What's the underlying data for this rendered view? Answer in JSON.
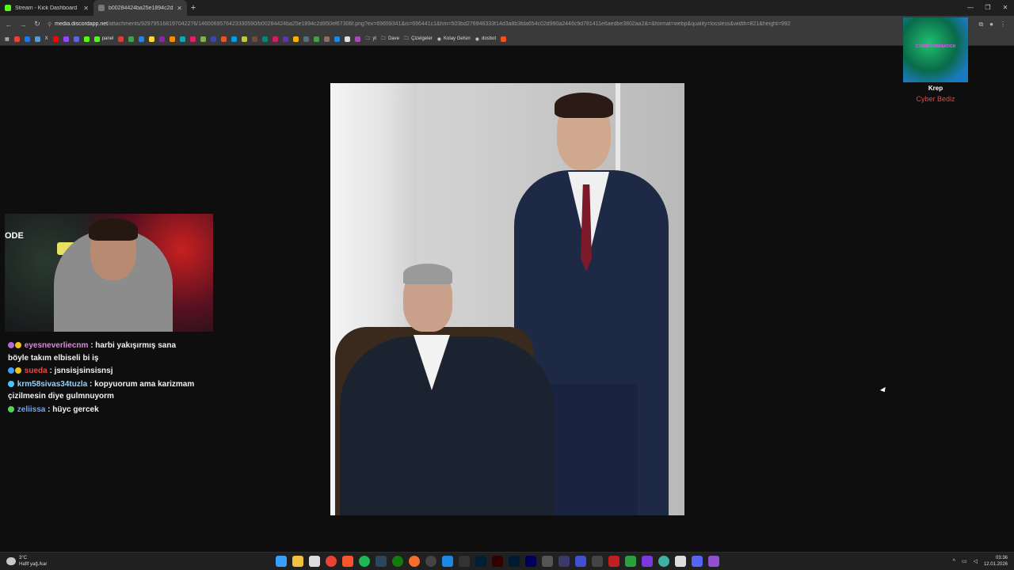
{
  "browser": {
    "tabs": [
      {
        "title": "Stream - Kick Dashboard",
        "color": "#53fc18",
        "active": false
      },
      {
        "title": "b00284424ba25e1894c2d950",
        "color": "#777777",
        "active": true
      }
    ],
    "url_host": "media.discordapp.net",
    "url_path": "/attachments/929795168197042276/1460069576423330590/b00284424ba25e1894c2d950ef67306f.png?ex=69659341&is=696441c1&hm=503bd276946333f14d3a8b3fda654c02d990a2446c9d781411e6aedbe3802aa2&=&format=webp&quality=lossless&width=821&height=992",
    "bookmarks": [
      {
        "label": "panel",
        "color": "#53fc18"
      },
      {
        "label": "yt",
        "color": "#cccccc"
      },
      {
        "label": "Dave",
        "color": "#cccccc"
      },
      {
        "label": "Çizelgeler",
        "color": "#cccccc"
      },
      {
        "label": "Kolay Gelsin",
        "color": "#ffffff"
      },
      {
        "label": "dosbot",
        "color": "#ffffff"
      }
    ]
  },
  "overlay": {
    "chat": [
      {
        "user": "eyesneverliecnm",
        "text": ": harbi yakışırmış sana böyle takım elbiseli bi iş",
        "badge_color": "#b06ad0"
      },
      {
        "user": "sueda",
        "text": ": jsnsisjsinsisnsj",
        "badge_color": "#3aa0ff"
      },
      {
        "user": "krm58sivas34tuzla",
        "text": ": kopyuorum ama karizmam çizilmesin diye gulmnuyorm",
        "badge_color": "#46c8ff"
      },
      {
        "user": "zeliissa",
        "text": ": hüyc gercek",
        "badge_color": "#53d45a"
      }
    ],
    "alert": {
      "banner": "CYBER DOMINATION",
      "name": "Krep",
      "message": "Cyber Bediz"
    },
    "cam_logo": "ODE"
  },
  "taskbar": {
    "weather_temp": "3°C",
    "weather_desc": "Hafif yağ./kar",
    "time": "03:36",
    "date": "12.01.2026"
  }
}
